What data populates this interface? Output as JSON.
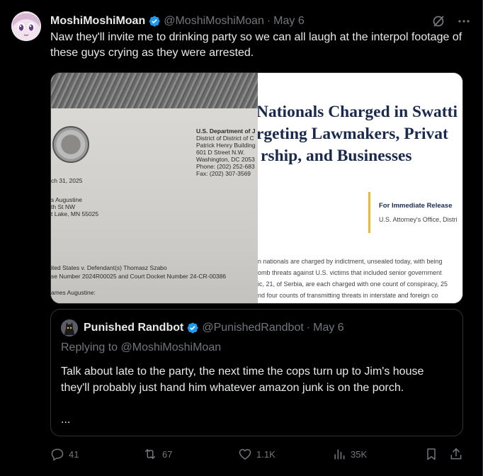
{
  "tweet": {
    "author_name": "MoshiMoshiMoan",
    "author_handle": "@MoshiMoshiMoan",
    "separator": "·",
    "date": "May 6",
    "text": "Naw they'll invite me to drinking party so we can all laugh at the interpol footage of these guys crying as they were arrested."
  },
  "media": {
    "letter": {
      "dept_lines": [
        "U.S. Department of J",
        "District of District of C",
        "Patrick Henry Building",
        "601 D Street N.W.",
        "Washington, DC 2053",
        "Phone: (202) 252-683",
        "Fax: (202) 307-3569"
      ],
      "date": "ch 31, 2025",
      "address_lines": [
        "s Augustine",
        "th St NW",
        "t Lake, MN 55025"
      ],
      "case_lines": [
        "ited States v. Defendant(s) Thomasz Szabo",
        "se Number 2024R00025 and Court Docket Number 24-CR-00386"
      ],
      "salutation": "ames Augustine:"
    },
    "press": {
      "title_lines": [
        "Nationals Charged in Swatti",
        "rgeting Lawmakers, Privat",
        "rship, and Businesses"
      ],
      "release_heading": "For Immediate Release",
      "release_office": "U.S. Attorney's Office, Distri",
      "body_lines": [
        "n nationals are charged by indictment, unsealed today, with being",
        "omb threats against U.S. victims that included senior government",
        "ic, 21, of Serbia, are each charged with one count of conspiracy, 25",
        "nd four counts of transmitting threats in interstate and foreign co"
      ]
    }
  },
  "quoted": {
    "author_name": "Punished Randbot",
    "author_handle": "@PunishedRandbot",
    "separator": "·",
    "date": "May 6",
    "replying_to": "Replying to @MoshiMoshiMoan",
    "text": "Talk about late to the party, the next time the cops turn up to Jim's house they'll probably just hand him whatever amazon junk is on the porch.",
    "more": "..."
  },
  "actions": {
    "replies": "41",
    "reposts": "67",
    "likes": "1.1K",
    "views": "35K"
  },
  "colors": {
    "background": "#000000",
    "text": "#e7e9ea",
    "muted": "#71767b",
    "verified": "#1d9bf0",
    "border": "#2f3336"
  },
  "icons": [
    "grok-icon",
    "more-icon",
    "verified-icon",
    "reply-icon",
    "repost-icon",
    "like-icon",
    "views-icon",
    "bookmark-icon",
    "share-icon"
  ]
}
